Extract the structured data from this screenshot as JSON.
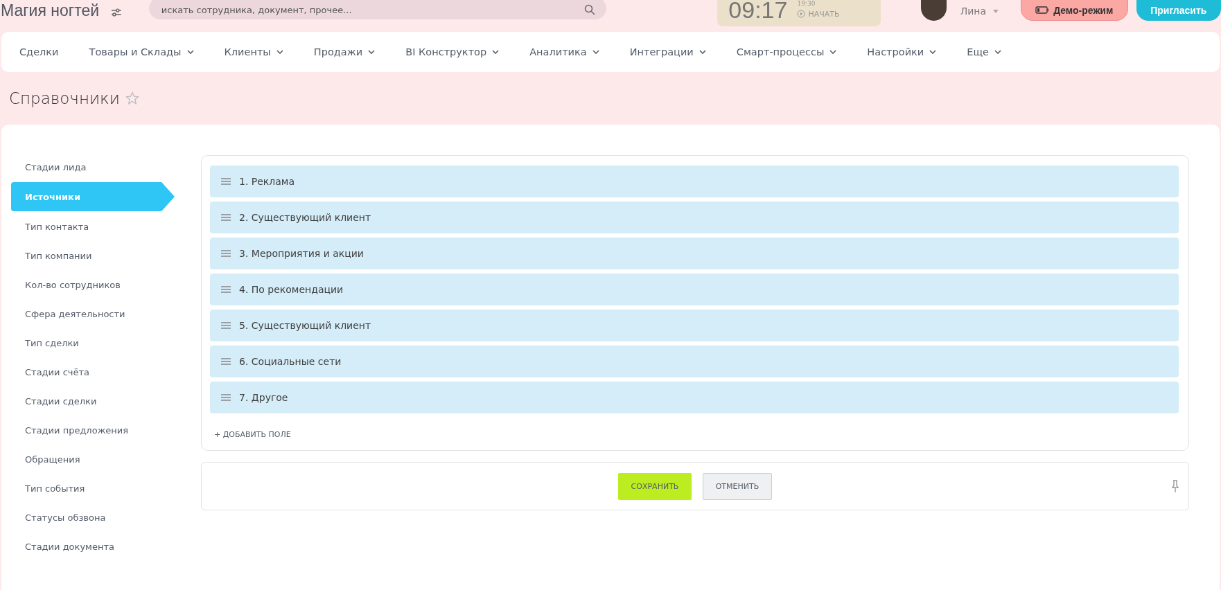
{
  "header": {
    "title": "Магия ногтей",
    "search": {
      "placeholder": "искать сотрудника, документ, прочее..."
    },
    "clock": {
      "time": "09:17",
      "alarm": "19:30",
      "start": "НАЧАТЬ"
    },
    "user": {
      "name": "Лина"
    },
    "demo": {
      "label": "Демо-режим"
    },
    "invite": {
      "label": "Пригласить"
    }
  },
  "nav": [
    {
      "label": "Сделки",
      "dropdown": false
    },
    {
      "label": "Товары и Склады",
      "dropdown": true
    },
    {
      "label": "Клиенты",
      "dropdown": true
    },
    {
      "label": "Продажи",
      "dropdown": true
    },
    {
      "label": "BI Конструктор",
      "dropdown": true
    },
    {
      "label": "Аналитика",
      "dropdown": true
    },
    {
      "label": "Интеграции",
      "dropdown": true
    },
    {
      "label": "Смарт-процессы",
      "dropdown": true
    },
    {
      "label": "Настройки",
      "dropdown": true
    },
    {
      "label": "Еще",
      "dropdown": true
    }
  ],
  "page_title": "Справочники",
  "sidebar": {
    "items": [
      {
        "label": "Стадии лида",
        "selected": false
      },
      {
        "label": "Источники",
        "selected": true
      },
      {
        "label": "Тип контакта",
        "selected": false
      },
      {
        "label": "Тип компании",
        "selected": false
      },
      {
        "label": "Кол-во сотрудников",
        "selected": false
      },
      {
        "label": "Сфера деятельности",
        "selected": false
      },
      {
        "label": "Тип сделки",
        "selected": false
      },
      {
        "label": "Стадии счёта",
        "selected": false
      },
      {
        "label": "Стадии сделки",
        "selected": false
      },
      {
        "label": "Стадии предложения",
        "selected": false
      },
      {
        "label": "Обращения",
        "selected": false
      },
      {
        "label": "Тип события",
        "selected": false
      },
      {
        "label": "Статусы обзвона",
        "selected": false
      },
      {
        "label": "Стадии документа",
        "selected": false
      }
    ]
  },
  "list": {
    "items": [
      "1. Реклама",
      "2. Существующий клиент",
      "3. Мероприятия и акции",
      "4. По рекомендации",
      "5. Существующий клиент",
      "6. Социальные сети",
      "7. Другое"
    ],
    "add_label": "+ ДОБАВИТЬ ПОЛЕ"
  },
  "buttons": {
    "save": "СОХРАНИТЬ",
    "cancel": "ОТМЕНИТЬ"
  }
}
